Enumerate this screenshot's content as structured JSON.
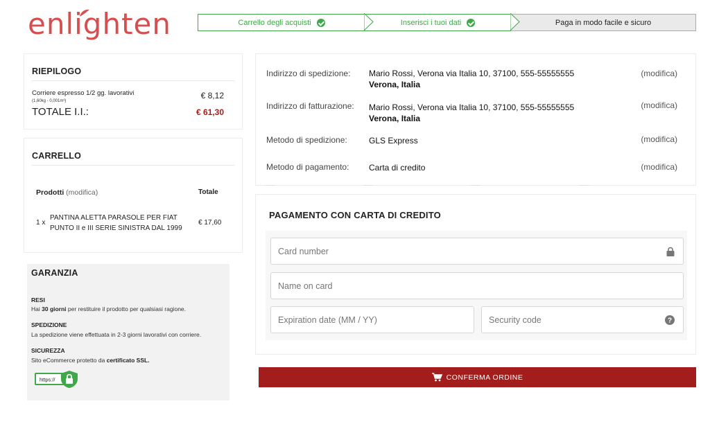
{
  "brand": {
    "logo_text": "enlighten"
  },
  "steps": [
    {
      "label": "Carrello degli acquisti",
      "status": "done"
    },
    {
      "label": "Inserisci i tuoi dati",
      "status": "done"
    },
    {
      "label": "Paga in modo facile e sicuro",
      "status": "current"
    }
  ],
  "summary": {
    "title": "RIEPILOGO",
    "shipping_label": "Corriere espresso 1/2 gg. lavorativi",
    "shipping_sub": "(1,60kg - 0,001m³)",
    "shipping_price": "€ 8,12",
    "total_label": "TOTALE I.I.:",
    "total_price": "€ 61,30"
  },
  "cart": {
    "title": "CARRELLO",
    "products_header": "Prodotti",
    "modify_label": "(modifica)",
    "total_header": "Totale",
    "items": [
      {
        "qty": "1 x",
        "name": "PANTINA ALETTA PARASOLE PER FIAT PUNTO II e III SERIE SINISTRA DAL 1999",
        "price": "€ 17,60"
      }
    ]
  },
  "guarantee": {
    "title": "GARANZIA",
    "returns_title": "RESI",
    "returns_pre": "Hai ",
    "returns_bold": "30 giorni",
    "returns_post": " per restituire il prodotto per qualsiasi ragione.",
    "shipping_title": "SPEDIZIONE",
    "shipping_text": "La spedizione viene effettuata in 2-3 giorni lavorativi con corriere.",
    "security_title": "SICUREZZA",
    "security_pre": "Sito eCommerce protetto da ",
    "security_bold": "certificato SSL.",
    "badge_text": "https://"
  },
  "details": {
    "rows": [
      {
        "label": "Indirizzo di spedizione:",
        "value_line1": "Mario Rossi, Verona via Italia 10, 37100,   555-55555555",
        "value_line2": "Verona, Italia",
        "modify": "(modifica)"
      },
      {
        "label": "Indirizzo di fatturazione:",
        "value_line1": "Mario Rossi, Verona via Italia 10, 37100,   555-55555555",
        "value_line2": "Verona, Italia",
        "modify": "(modifica)"
      },
      {
        "label": "Metodo di spedizione:",
        "value_line1": "GLS Express",
        "modify": "(modifica)"
      },
      {
        "label": "Metodo di pagamento:",
        "value_line1": "Carta di credito",
        "modify": "(modifica)"
      }
    ]
  },
  "payment": {
    "title": "PAGAMENTO CON CARTA DI CREDITO",
    "card_number_placeholder": "Card number",
    "name_placeholder": "Name on card",
    "expiry_placeholder": "Expiration date (MM / YY)",
    "cvv_placeholder": "Security code"
  },
  "confirm_button": {
    "label": "CONFERMA ORDINE"
  },
  "colors": {
    "brand_red": "#d45050",
    "accent_red": "#a41d1d",
    "success_green": "#3ea84a"
  },
  "icons": [
    "leaf-icon",
    "check-icon",
    "lock-icon",
    "help-icon",
    "cart-icon",
    "shield-lock-icon"
  ]
}
